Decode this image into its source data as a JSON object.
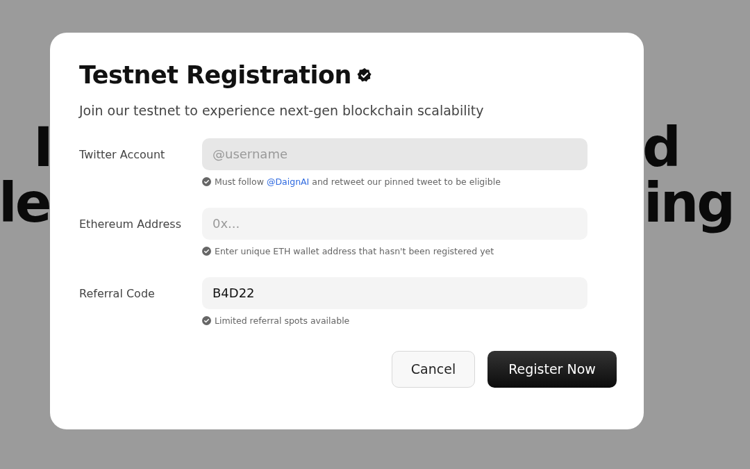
{
  "background_text": [
    {
      "left": "I",
      "right": "d"
    },
    {
      "left": "le",
      "right": "ing"
    }
  ],
  "dialog": {
    "title": "Testnet Registration",
    "verified": true,
    "subtitle": "Join our testnet to experience next-gen blockchain scalability",
    "fields": [
      {
        "label": "Twitter Account",
        "placeholder": "@username",
        "highlighted": true,
        "hint": [
          {
            "text": "Must follow "
          },
          {
            "text": "@DaignAI",
            "kind": "link"
          },
          {
            "text": " and retweet our pinned tweet to be eligible"
          }
        ]
      },
      {
        "label": "Ethereum Address",
        "placeholder": "0x...",
        "highlighted": false,
        "hint": [
          {
            "text": "Enter unique ETH wallet address that hasn't been registered yet"
          }
        ]
      },
      {
        "label": "Referral Code",
        "value": "B4D22",
        "highlighted": false,
        "hint": [
          {
            "text": "Limited referral spots available"
          }
        ]
      }
    ],
    "buttons": [
      {
        "label": "Cancel",
        "kind": "secondary"
      },
      {
        "label": "Register Now",
        "kind": "primary"
      }
    ]
  }
}
